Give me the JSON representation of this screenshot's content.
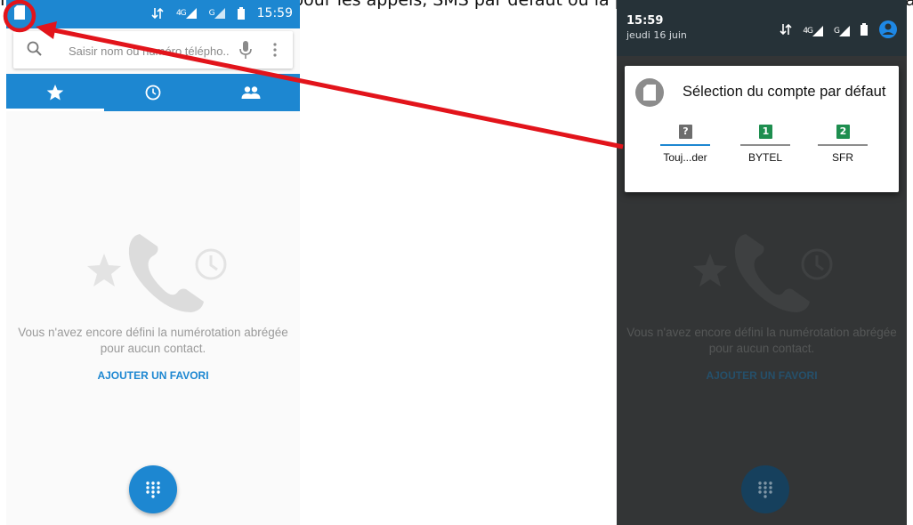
{
  "caption": "Il apparait alors la SIM par défaut, pour les appels, SMS par défaut ou la par défaut à partir de la barre d'état",
  "left_screen": {
    "status_bar": {
      "time": "15:59",
      "net1": "4G",
      "net2": "G"
    },
    "search": {
      "placeholder": "Saisir nom ou numéro télépho..."
    },
    "tabs": [
      {
        "icon": "star-icon"
      },
      {
        "icon": "clock-icon"
      },
      {
        "icon": "people-icon"
      }
    ],
    "empty_message": "Vous n'avez encore défini la numérotation abrégée pour aucun contact.",
    "add_favorite": "AJOUTER UN FAVORI"
  },
  "right_screen": {
    "status": {
      "time": "15:59",
      "date": "jeudi 16 juin",
      "net1": "4G",
      "net2": "G"
    },
    "dialog": {
      "title": "Sélection du compte par défaut",
      "options": [
        {
          "badge": "?",
          "label": "Touj...der",
          "color": "#6d6d6d",
          "underline": "#1d87d1"
        },
        {
          "badge": "1",
          "label": "BYTEL",
          "color": "#1e8e4f",
          "underline": "#8c8c8c"
        },
        {
          "badge": "2",
          "label": "SFR",
          "color": "#1e8e4f",
          "underline": "#8c8c8c"
        }
      ]
    },
    "empty_message": "Vous n'avez encore défini la numérotation abrégée pour aucun contact.",
    "add_favorite": "AJOUTER UN FAVORI"
  },
  "colors": {
    "primary": "#1d87d1",
    "annotation": "#e2141b"
  }
}
